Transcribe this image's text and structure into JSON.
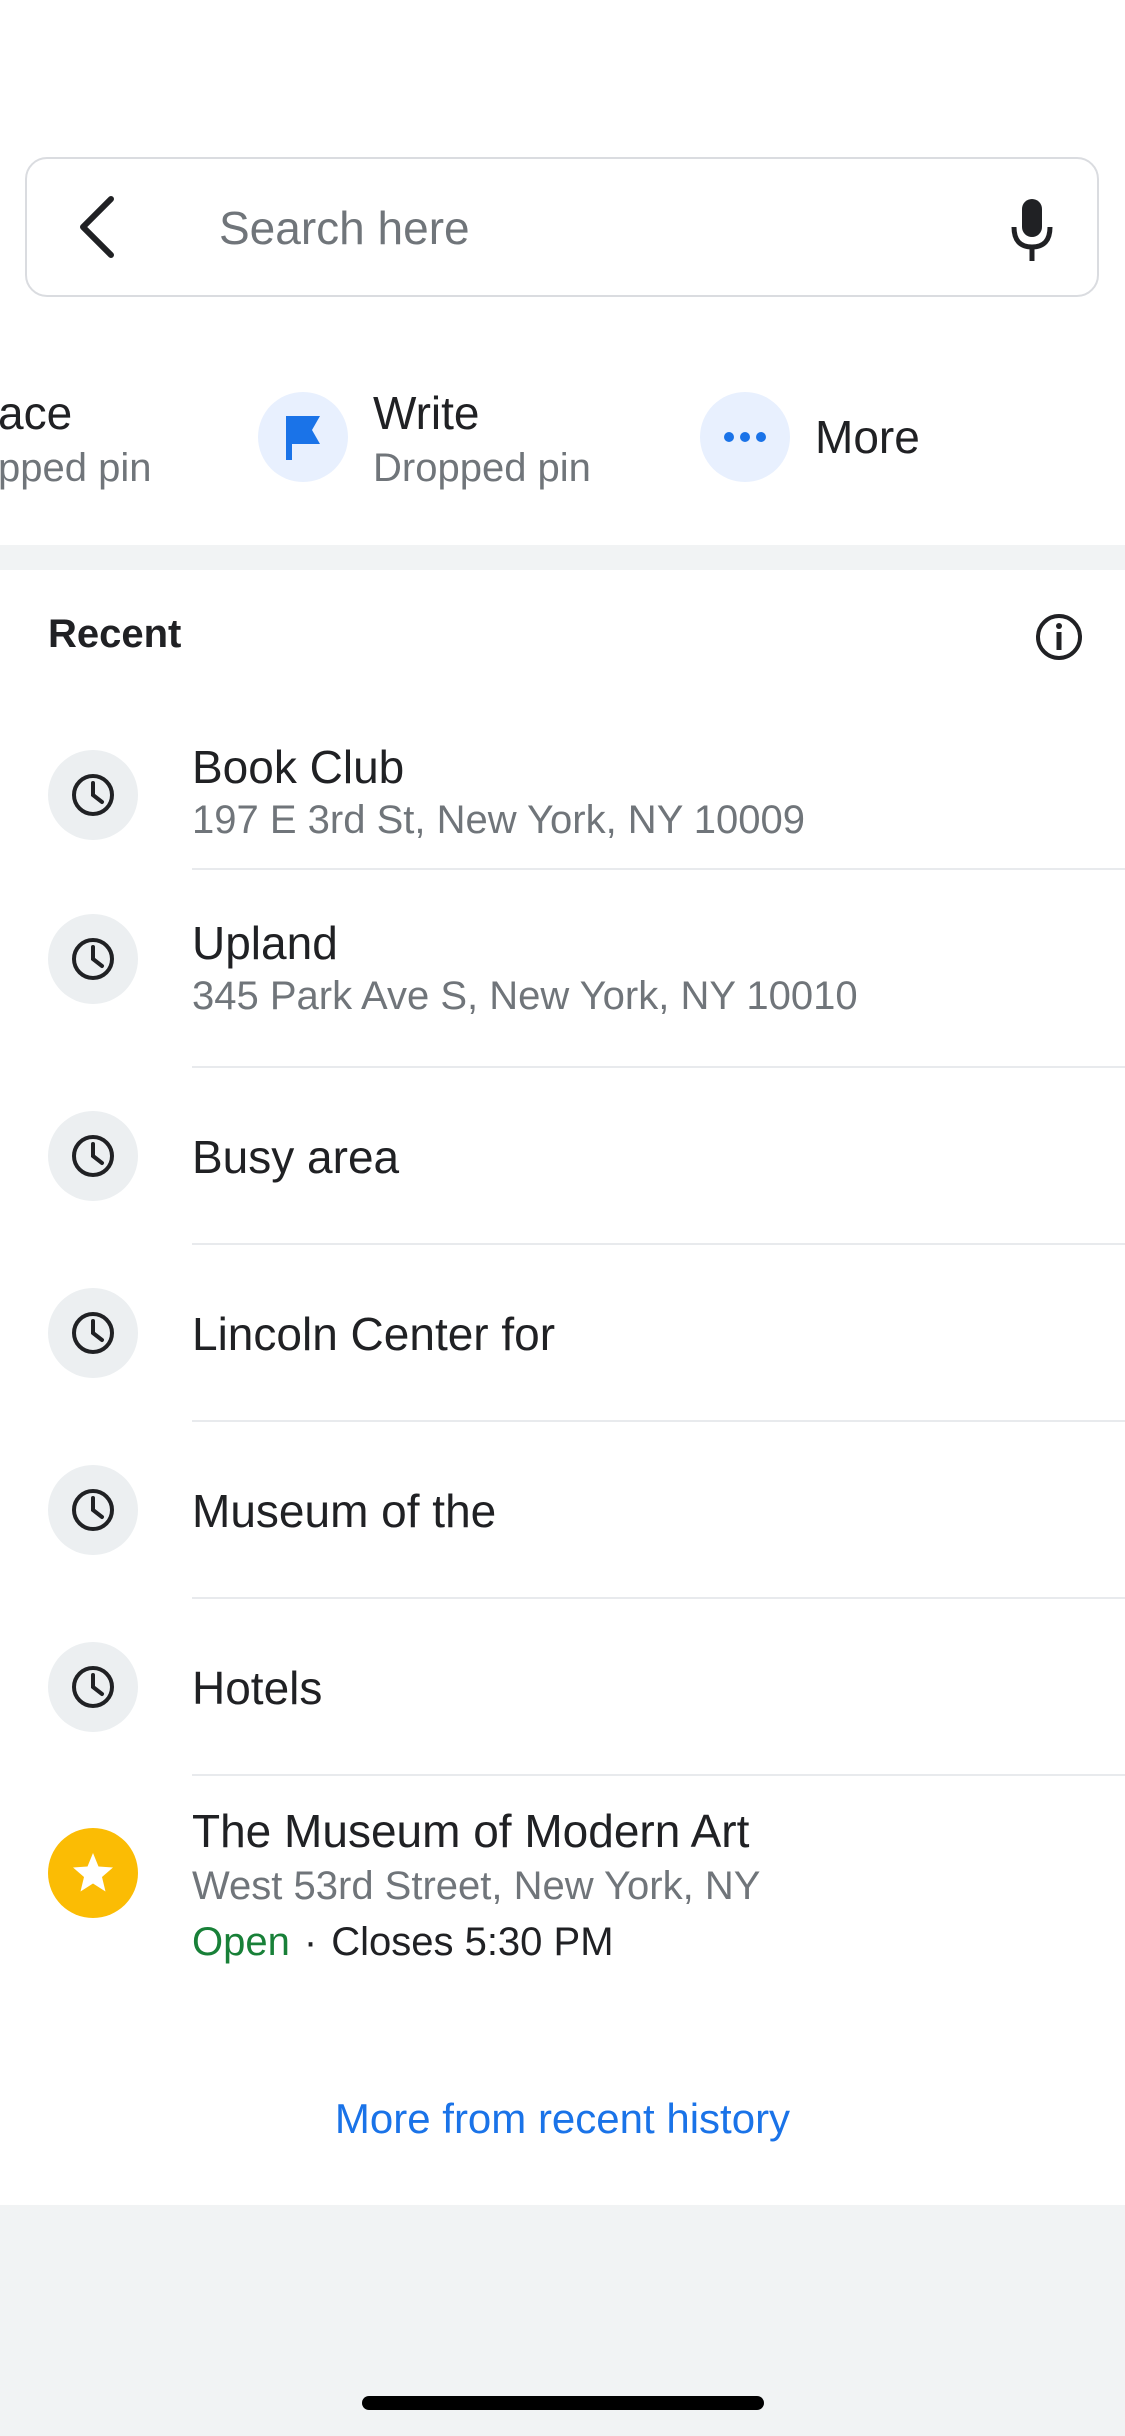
{
  "search": {
    "placeholder": "Search here",
    "value": ""
  },
  "quick_actions": [
    {
      "title": "ace",
      "subtitle": "pped pin"
    },
    {
      "title": "Write",
      "subtitle": "Dropped pin",
      "icon": "flag-icon"
    },
    {
      "title": "More",
      "icon": "more-dots-icon"
    }
  ],
  "recent": {
    "header": "Recent",
    "items": [
      {
        "name": "Book Club",
        "address": "197 E 3rd St, New York, NY 10009",
        "icon": "history-clock-icon"
      },
      {
        "name": "Upland",
        "address": "345 Park Ave S, New York, NY 10010",
        "icon": "history-clock-icon"
      },
      {
        "name": "Busy area",
        "icon": "history-clock-icon"
      },
      {
        "name": "Lincoln Center for",
        "icon": "history-clock-icon"
      },
      {
        "name": "Museum of the",
        "icon": "history-clock-icon"
      },
      {
        "name": "Hotels",
        "icon": "history-clock-icon"
      },
      {
        "name": "The Museum of Modern Art",
        "address": "West 53rd Street, New York, NY",
        "status": "Open",
        "separator": "·",
        "hours": "Closes 5:30 PM",
        "icon": "star-icon"
      }
    ],
    "more_link": "More from recent history"
  },
  "colors": {
    "accent_blue": "#1a73e8",
    "open_green": "#188038",
    "star_yellow": "#fbbc04",
    "secondary_text": "#70757a",
    "background_gray": "#f1f3f4"
  }
}
